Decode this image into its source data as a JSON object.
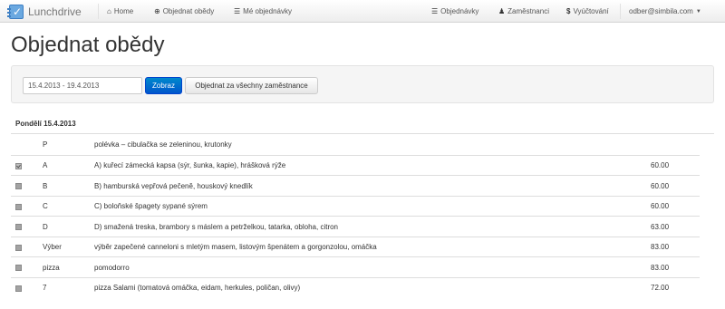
{
  "navbar": {
    "brand": "Lunchdrive",
    "home": "Home",
    "order_lunch": "Objednat obědy",
    "my_orders": "Mé objednávky",
    "orders": "Objednávky",
    "employees": "Zaměstnanci",
    "billing": "Vyúčtování",
    "user": "odber@simbila.com",
    "icons": {
      "home": "home-icon",
      "order_lunch": "plus-circle-icon",
      "my_orders": "list-icon",
      "orders": "list-icon",
      "employees": "user-icon",
      "billing": "dollar-icon",
      "user": "chevron-down-icon"
    }
  },
  "page": {
    "title": "Objednat obědy"
  },
  "filter": {
    "date_range_value": "15.4.2013 - 19.4.2013",
    "show_label": "Zobraz",
    "order_all_label": "Objednat za všechny zaměstnance"
  },
  "day": {
    "heading": "Pondělí 15.4.2013",
    "items": [
      {
        "code": "P",
        "description": "polévka – cibulačka se zeleninou, krutonky",
        "price": "",
        "has_checkbox": false,
        "checked": false
      },
      {
        "code": "A",
        "description": "A) kuřecí zámecká kapsa (sýr, šunka, kapie), hrášková rýže",
        "price": "60.00",
        "has_checkbox": true,
        "checked": true
      },
      {
        "code": "B",
        "description": "B) hamburská vepřová pečeně, houskový knedlík",
        "price": "60.00",
        "has_checkbox": true,
        "checked": false
      },
      {
        "code": "C",
        "description": "C) boloňské špagety sypané sýrem",
        "price": "60.00",
        "has_checkbox": true,
        "checked": false
      },
      {
        "code": "D",
        "description": "D) smažená treska, brambory s máslem a petrželkou, tatarka, obloha, citron",
        "price": "63.00",
        "has_checkbox": true,
        "checked": false
      },
      {
        "code": "Výber",
        "description": "výběr zapečené canneloni s mletým masem, listovým špenátem a gorgonzolou, omáčka",
        "price": "83.00",
        "has_checkbox": true,
        "checked": false
      },
      {
        "code": "pizza",
        "description": "pomodorro",
        "price": "83.00",
        "has_checkbox": true,
        "checked": false
      },
      {
        "code": "7",
        "description": "pizza Salami (tomatová omáčka, eidam, herkules, poličan, olivy)",
        "price": "72.00",
        "has_checkbox": true,
        "checked": false
      }
    ]
  },
  "colors": {
    "primary_button": "#0055cc",
    "navbar_bg": "#f5f5f5",
    "well_bg": "#f5f5f5",
    "row_border": "#dddddd"
  }
}
